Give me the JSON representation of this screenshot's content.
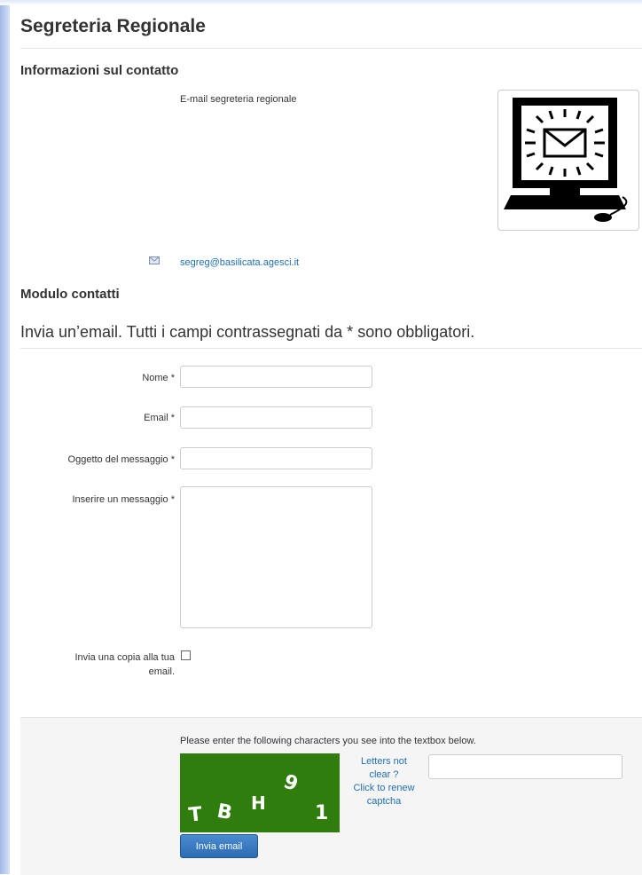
{
  "page": {
    "title": "Segreteria Regionale"
  },
  "contact": {
    "heading": "Informazioni sul contatto",
    "position": "E-mail segreteria regionale",
    "email": "segreg@basilicata.agesci.it",
    "image_icon": "computer-mail-icon",
    "email_icon": "envelope-icon"
  },
  "form": {
    "heading": "Modulo contatti",
    "legend": "Invia un’email. Tutti i campi contrassegnati da * sono obbligatori.",
    "name_label": "Nome *",
    "email_label": "Email *",
    "subject_label": "Oggetto del messaggio *",
    "message_label": "Inserire un messaggio *",
    "copy_label_line1": "Invia una copia alla tua",
    "copy_label_line2": "email.",
    "name_value": "",
    "email_value": "",
    "subject_value": "",
    "message_value": "",
    "copy_checked": false
  },
  "captcha": {
    "instruction": "Please enter the following characters you see into the textbox below.",
    "renew_line1": "Letters not",
    "renew_line2": "clear ?",
    "renew_line3": "Click to renew",
    "renew_line4": "captcha",
    "characters": [
      "T",
      "B",
      "H",
      "9",
      "1"
    ],
    "value": ""
  },
  "buttons": {
    "submit": "Invia email"
  },
  "colors": {
    "link": "#1f6fb3",
    "captcha_bg": "#2f7d0c",
    "button": "#2d6cb5"
  }
}
